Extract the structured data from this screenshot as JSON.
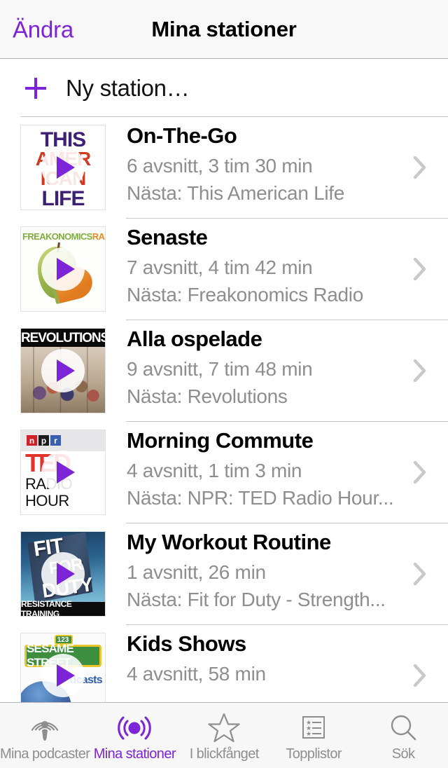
{
  "navbar": {
    "back_label": "Ändra",
    "title": "Mina stationer"
  },
  "new_station": {
    "label": "Ny station…",
    "icon": "plus-icon"
  },
  "stations": [
    {
      "title": "On-The-Go",
      "subtitle": "6 avsnitt, 3 tim 30 min",
      "next": "Nästa: This American Life",
      "artwork": "this-american-life",
      "art_text": {
        "l1": "THIS",
        "l2": "AMER",
        "l3": "ICAN",
        "l4": "LIFE"
      }
    },
    {
      "title": "Senaste",
      "subtitle": "7 avsnitt, 4 tim 42 min",
      "next": "Nästa: Freakonomics Radio",
      "artwork": "freakonomics-radio",
      "art_text": {
        "b1": "FREAKONOMICS",
        "b2": "RADIO"
      }
    },
    {
      "title": "Alla ospelade",
      "subtitle": "9 avsnitt, 7 tim 48 min",
      "next": "Nästa: Revolutions",
      "artwork": "revolutions",
      "art_text": {
        "l1": "REVOLUTIONS"
      }
    },
    {
      "title": "Morning Commute",
      "subtitle": "4 avsnitt, 1 tim 3 min",
      "next": "Nästa: NPR: TED Radio Hour...",
      "artwork": "npr-ted-radio-hour",
      "art_text": {
        "n": "n",
        "p": "p",
        "r": "r",
        "ted": "TED",
        "radio": "RADIO",
        "hour": "HOUR"
      }
    },
    {
      "title": "My Workout Routine",
      "subtitle": "1 avsnitt, 26 min",
      "next": "Nästa: Fit for Duty - Strength...",
      "artwork": "fit-for-duty",
      "art_text": {
        "w1": "FIT",
        "w2": "FOR",
        "w3": "DUTY",
        "bar": "RESISTANCE TRAINING"
      }
    },
    {
      "title": "Kids Shows",
      "subtitle": "4 avsnitt, 58 min",
      "next": "",
      "artwork": "sesame-street",
      "art_text": {
        "num": "123",
        "sign": "SESAME STREET",
        "dcasts": "dcasts"
      }
    }
  ],
  "tabbar": {
    "items": [
      {
        "label": "Mina podcaster",
        "icon": "podcast-icon",
        "active": false
      },
      {
        "label": "Mina stationer",
        "icon": "broadcast-icon",
        "active": true
      },
      {
        "label": "I blickfånget",
        "icon": "star-icon",
        "active": false
      },
      {
        "label": "Topplistor",
        "icon": "top-charts-icon",
        "active": false
      },
      {
        "label": "Sök",
        "icon": "search-icon",
        "active": false
      }
    ]
  },
  "colors": {
    "accent": "#7d23d8",
    "secondary_text": "#8e8e8e",
    "separator": "#c8c8c8",
    "navbar_bg": "#f8f8f8",
    "tabbar_bg": "#f7f7f7"
  }
}
